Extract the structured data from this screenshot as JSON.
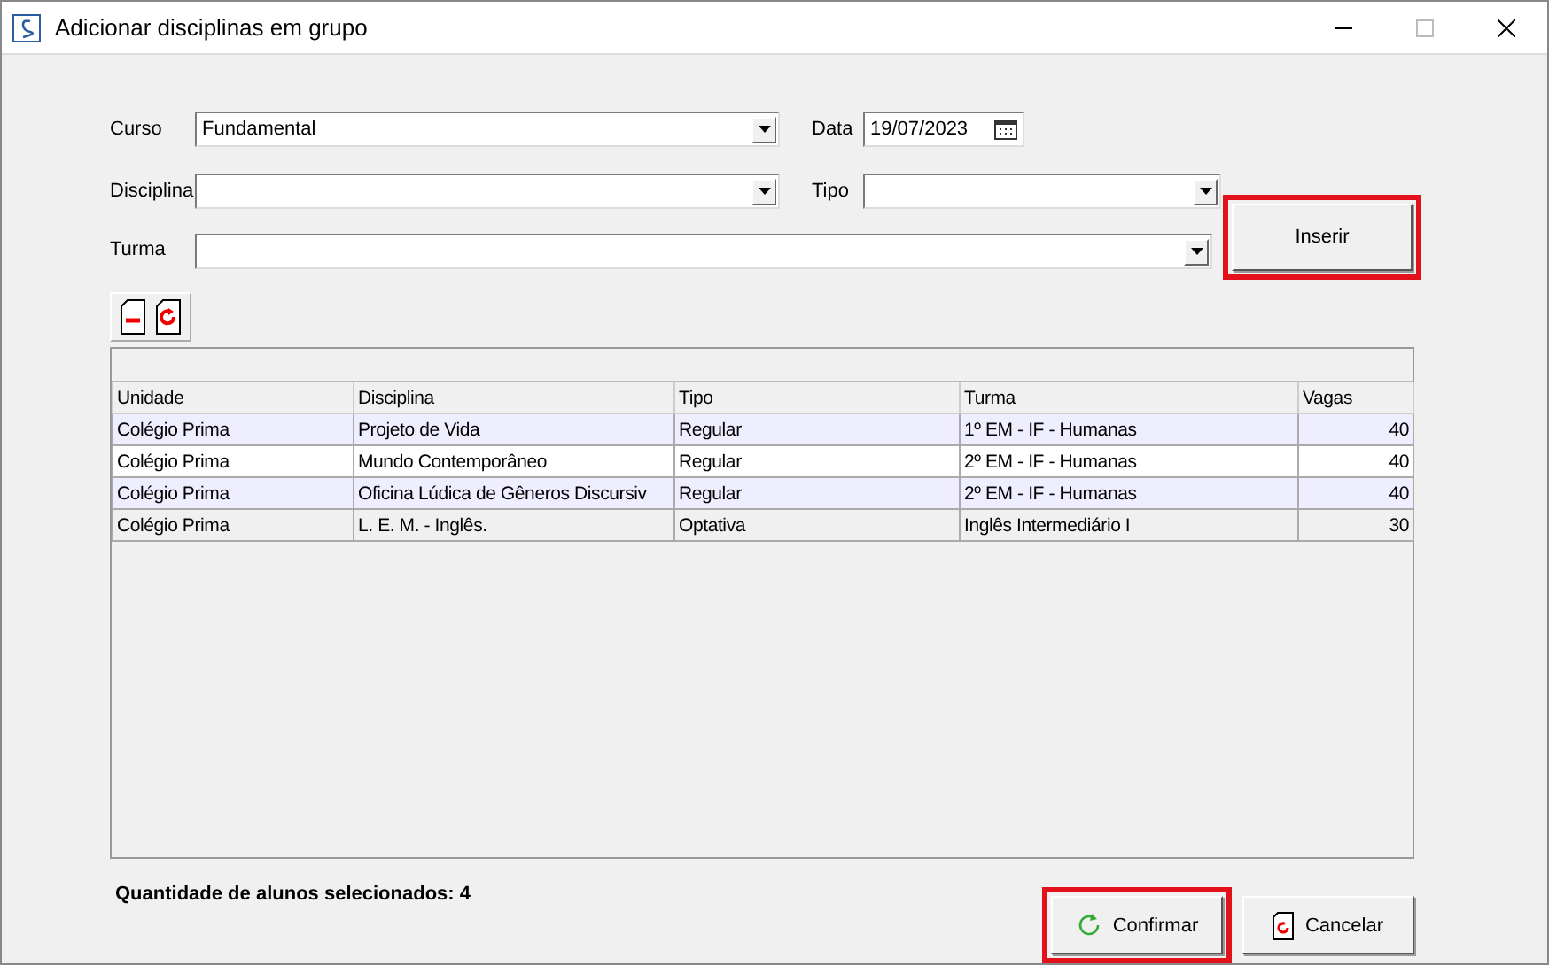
{
  "window": {
    "title": "Adicionar disciplinas em grupo"
  },
  "form": {
    "curso": {
      "label": "Curso",
      "value": "Fundamental"
    },
    "data": {
      "label": "Data",
      "value": "19/07/2023"
    },
    "disciplina": {
      "label": "Disciplina"
    },
    "tipo": {
      "label": "Tipo"
    },
    "turma": {
      "label": "Turma"
    }
  },
  "insert_button": {
    "label": "Inserir",
    "highlighted": true
  },
  "table": {
    "columns": [
      "Unidade",
      "Disciplina",
      "Tipo",
      "Turma",
      "Vagas"
    ],
    "rows": [
      {
        "cells": [
          "Colégio Prima",
          "Projeto de Vida",
          "Regular",
          "1º EM - IF - Humanas",
          "40"
        ],
        "selected": false
      },
      {
        "cells": [
          "Colégio Prima",
          "Mundo Contemporâneo",
          "Regular",
          "2º EM - IF - Humanas",
          "40"
        ],
        "selected": false
      },
      {
        "cells": [
          "Colégio Prima",
          "Oficina Lúdica de Gêneros Discursiv",
          "Regular",
          "2º EM - IF - Humanas",
          "40"
        ],
        "selected": false
      },
      {
        "cells": [
          "Colégio Prima",
          "L. E. M. - Inglês.",
          "Optativa",
          "Inglês Intermediário I",
          "30"
        ],
        "selected": true
      }
    ]
  },
  "status": "Quantidade de alunos selecionados: 4",
  "buttons": [
    {
      "kind": "confirm",
      "label": "Confirmar",
      "highlighted": true
    },
    {
      "kind": "cancel",
      "label": "Cancelar",
      "highlighted": false
    }
  ]
}
